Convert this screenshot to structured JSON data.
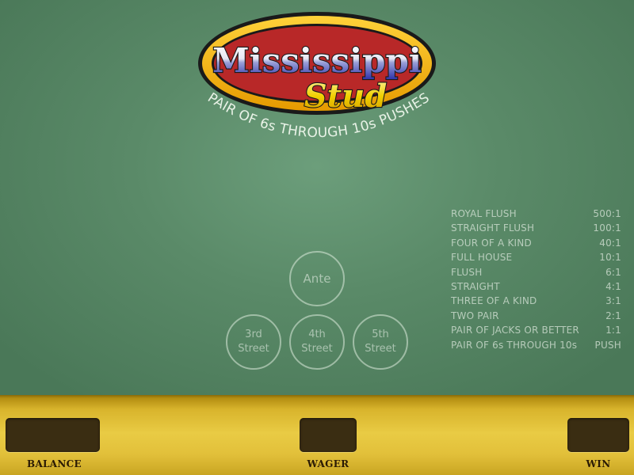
{
  "logo": {
    "title": "Mississippi",
    "subtitle": "Stud",
    "tagline": "PAIR OF 6s THROUGH 10s PUSHES",
    "colors": {
      "outer_ring": "#f2b400",
      "inner_oval": "#b82828",
      "title_fill_top": "#ffffff",
      "title_fill_bottom": "#2a2fa8",
      "subtitle_fill": "#f0d000",
      "tagline": "#e8f2e6"
    }
  },
  "bet_spots": {
    "ante": "Ante",
    "third_street": "3rd\nStreet",
    "fourth_street": "4th\nStreet",
    "fifth_street": "5th\nStreet"
  },
  "paytable": [
    {
      "hand": "ROYAL FLUSH",
      "payout": "500:1"
    },
    {
      "hand": "STRAIGHT FLUSH",
      "payout": "100:1"
    },
    {
      "hand": "FOUR OF A KIND",
      "payout": "40:1"
    },
    {
      "hand": "FULL HOUSE",
      "payout": "10:1"
    },
    {
      "hand": "FLUSH",
      "payout": "6:1"
    },
    {
      "hand": "STRAIGHT",
      "payout": "4:1"
    },
    {
      "hand": "THREE OF A KIND",
      "payout": "3:1"
    },
    {
      "hand": "TWO PAIR",
      "payout": "2:1"
    },
    {
      "hand": "PAIR OF JACKS OR BETTER",
      "payout": "1:1"
    },
    {
      "hand": "PAIR OF 6s THROUGH 10s",
      "payout": "PUSH"
    }
  ],
  "bottom_bar": {
    "balance_label": "BALANCE",
    "wager_label": "WAGER",
    "win_label": "WIN",
    "balance_value": "",
    "wager_value": "",
    "win_value": ""
  },
  "colors": {
    "felt": "#5a8a68",
    "bar_gold": "#e2c03a",
    "display_box": "#3a2d12"
  }
}
